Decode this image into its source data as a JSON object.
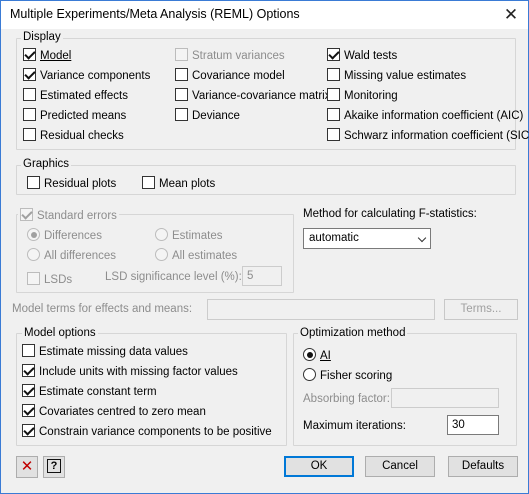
{
  "window": {
    "title": "Multiple Experiments/Meta Analysis (REML) Options",
    "close_glyph": "✕"
  },
  "display": {
    "label": "Display",
    "options": [
      {
        "label": "Model",
        "checked": true,
        "enabled": true
      },
      {
        "label": "Variance components",
        "checked": true,
        "enabled": true
      },
      {
        "label": "Estimated effects",
        "checked": false,
        "enabled": true
      },
      {
        "label": "Predicted means",
        "checked": false,
        "enabled": true
      },
      {
        "label": "Residual checks",
        "checked": false,
        "enabled": true
      },
      {
        "label": "Stratum variances",
        "checked": false,
        "enabled": false
      },
      {
        "label": "Covariance model",
        "checked": false,
        "enabled": true
      },
      {
        "label": "Variance-covariance matrix",
        "checked": false,
        "enabled": true
      },
      {
        "label": "Deviance",
        "checked": false,
        "enabled": true
      },
      {
        "label": "Wald tests",
        "checked": true,
        "enabled": true
      },
      {
        "label": "Missing value estimates",
        "checked": false,
        "enabled": true
      },
      {
        "label": "Monitoring",
        "checked": false,
        "enabled": true
      },
      {
        "label": "Akaike information coefficient (AIC)",
        "checked": false,
        "enabled": true
      },
      {
        "label": "Schwarz information coefficient (SIC)",
        "checked": false,
        "enabled": true
      }
    ]
  },
  "graphics": {
    "label": "Graphics",
    "options": [
      {
        "label": "Residual plots",
        "checked": false
      },
      {
        "label": "Mean plots",
        "checked": false
      }
    ]
  },
  "standard_errors": {
    "label": "Standard errors",
    "checked": true,
    "enabled": false,
    "radios_left": [
      {
        "label": "Differences",
        "checked": true
      },
      {
        "label": "All differences",
        "checked": false
      }
    ],
    "radios_right": [
      {
        "label": "Estimates",
        "checked": false
      },
      {
        "label": "All estimates",
        "checked": false
      }
    ],
    "lsds_label": "LSDs",
    "lsd_level_label": "LSD significance level (%):",
    "lsd_level_value": "5"
  },
  "f_statistics": {
    "label": "Method for calculating F-statistics:",
    "selected": "automatic"
  },
  "model_terms": {
    "label": "Model terms for effects and means:",
    "value": "",
    "button_label": "Terms..."
  },
  "model_options": {
    "label": "Model options",
    "options": [
      {
        "label": "Estimate missing data values",
        "checked": false
      },
      {
        "label": "Include units with missing factor values",
        "checked": true
      },
      {
        "label": "Estimate constant term",
        "checked": true
      },
      {
        "label": "Covariates centred to zero mean",
        "checked": true
      },
      {
        "label": "Constrain variance components to be positive",
        "checked": true
      }
    ]
  },
  "optimization": {
    "label": "Optimization method",
    "methods": [
      {
        "label": "AI",
        "checked": true
      },
      {
        "label": "Fisher scoring",
        "checked": false
      }
    ],
    "absorbing_label": "Absorbing factor:",
    "absorbing_value": "",
    "max_iter_label": "Maximum iterations:",
    "max_iter_value": "30"
  },
  "footer": {
    "clear_icon": "✕",
    "help_icon": "?",
    "ok_label": "OK",
    "cancel_label": "Cancel",
    "defaults_label": "Defaults"
  },
  "colors": {
    "focus_border": "#0078d7",
    "clear_icon": "#c00000"
  }
}
